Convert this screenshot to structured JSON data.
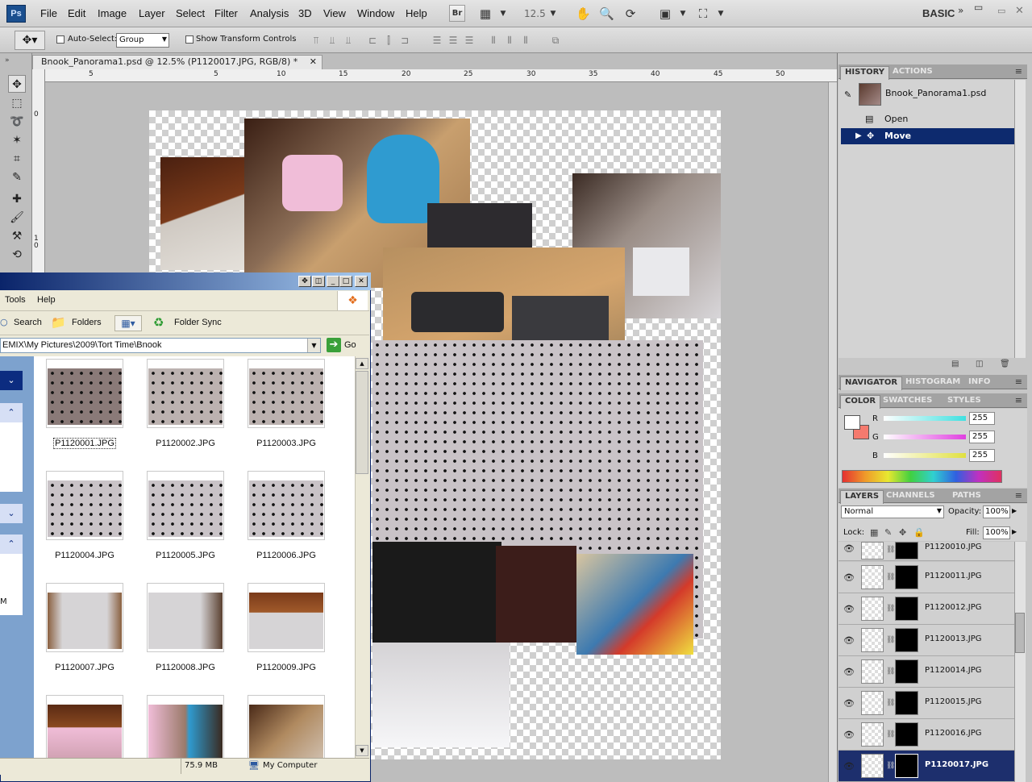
{
  "app": {
    "logo": "Ps",
    "menus": [
      "File",
      "Edit",
      "Image",
      "Layer",
      "Select",
      "Filter",
      "Analysis",
      "3D",
      "View",
      "Window",
      "Help"
    ],
    "bridge_label": "Br",
    "zoom": "12.5",
    "workspace": "BASIC"
  },
  "options": {
    "auto_select_label": "Auto-Select:",
    "auto_select_value": "Group",
    "show_transform_label": "Show Transform Controls"
  },
  "document": {
    "tab_title": "Bnook_Panorama1.psd @ 12.5% (P1120017.JPG, RGB/8) *",
    "ruler_h": [
      "5",
      "5",
      "10",
      "15",
      "20",
      "25",
      "30",
      "35",
      "40",
      "45",
      "50"
    ],
    "ruler_v": [
      "0",
      "1 0"
    ]
  },
  "history": {
    "tabs": [
      "HISTORY",
      "ACTIONS"
    ],
    "snapshot": "Bnook_Panorama1.psd",
    "items": [
      "Open",
      "Move"
    ]
  },
  "navigator": {
    "tabs": [
      "NAVIGATOR",
      "HISTOGRAM",
      "INFO"
    ]
  },
  "color": {
    "tabs": [
      "COLOR",
      "SWATCHES",
      "STYLES"
    ],
    "channels": [
      {
        "label": "R",
        "value": "255",
        "color": "#3fe0e0"
      },
      {
        "label": "G",
        "value": "255",
        "color": "#e040e0"
      },
      {
        "label": "B",
        "value": "255",
        "color": "#e0e040"
      }
    ]
  },
  "layers": {
    "tabs": [
      "LAYERS",
      "CHANNELS",
      "PATHS"
    ],
    "blend_mode": "Normal",
    "opacity_label": "Opacity:",
    "opacity": "100%",
    "lock_label": "Lock:",
    "fill_label": "Fill:",
    "fill": "100%",
    "items": [
      "P1120010.JPG",
      "P1120011.JPG",
      "P1120012.JPG",
      "P1120013.JPG",
      "P1120014.JPG",
      "P1120015.JPG",
      "P1120016.JPG",
      "P1120017.JPG"
    ]
  },
  "explorer": {
    "menus": [
      "Tools",
      "Help"
    ],
    "search_label": "Search",
    "folders_label": "Folders",
    "folder_sync_label": "Folder Sync",
    "address": "EMIX\\My Pictures\\2009\\Tort Time\\Bnook",
    "go_label": "Go",
    "files": [
      "P1120001.JPG",
      "P1120002.JPG",
      "P1120003.JPG",
      "P1120004.JPG",
      "P1120005.JPG",
      "P1120006.JPG",
      "P1120007.JPG",
      "P1120008.JPG",
      "P1120009.JPG"
    ],
    "status_size": "75.9 MB",
    "status_location": "My Computer",
    "left_letter": "M"
  }
}
